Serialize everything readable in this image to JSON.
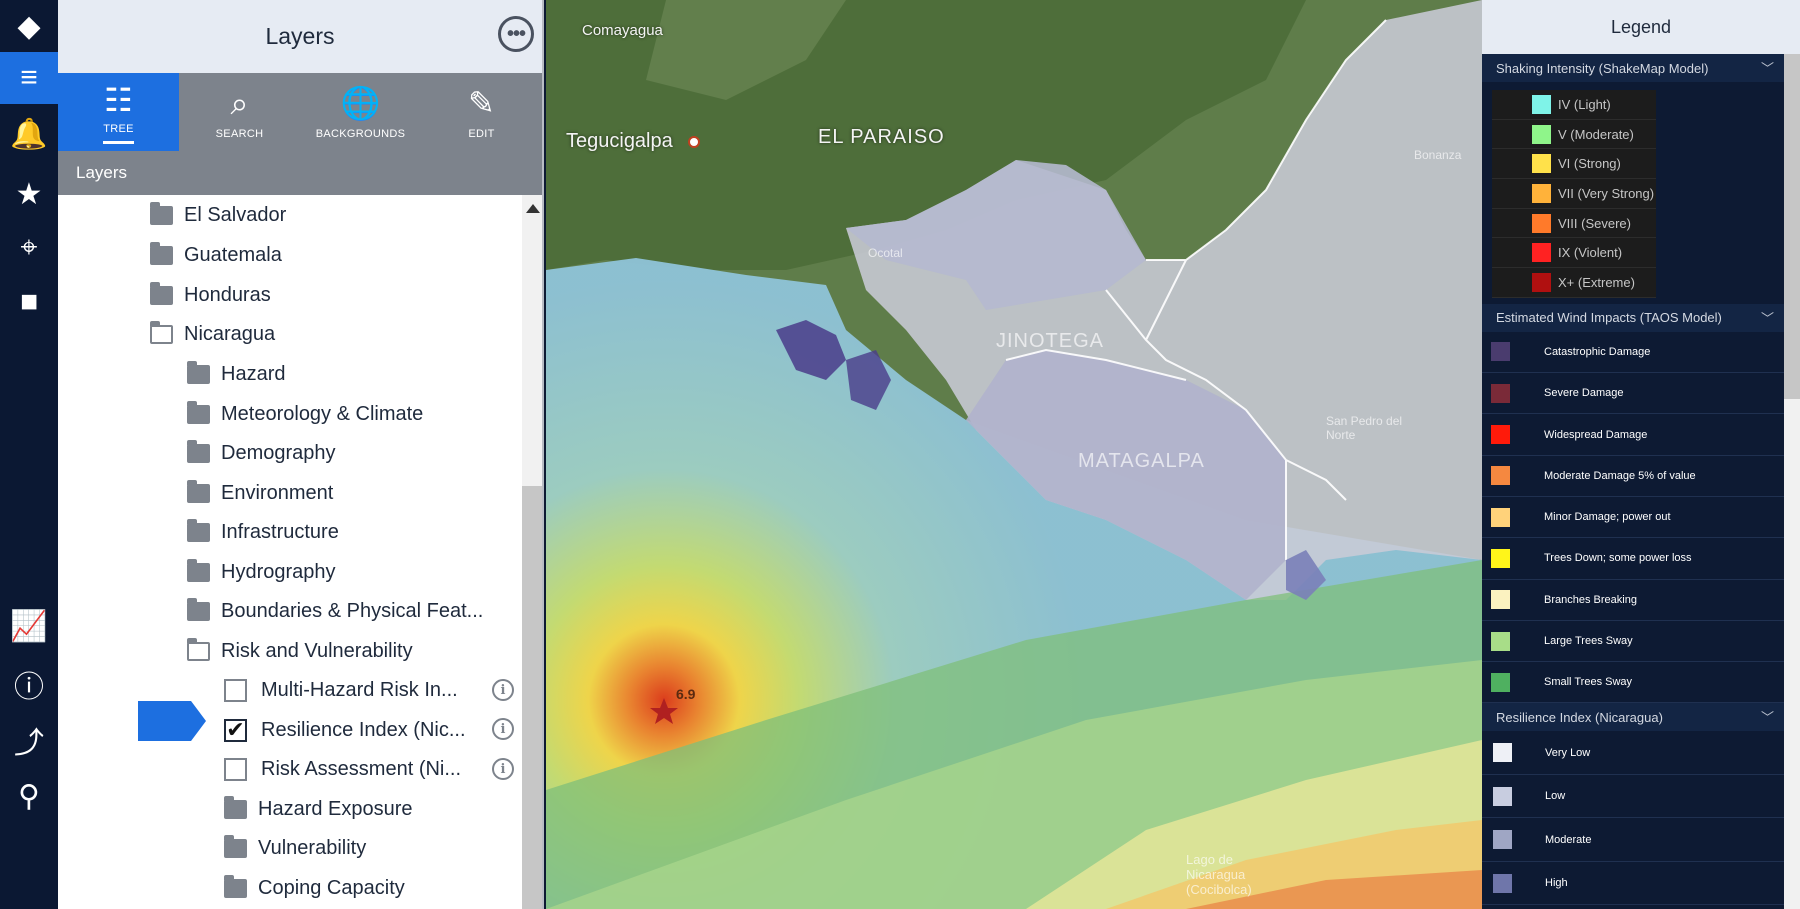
{
  "rail": {
    "items": [
      {
        "name": "alert-diamond-icon",
        "glyph": "◆"
      },
      {
        "name": "layers-stack-icon",
        "glyph": "≡"
      },
      {
        "name": "bell-alert-icon",
        "glyph": "🔔"
      },
      {
        "name": "star-icon",
        "glyph": "★"
      },
      {
        "name": "location-pin-icon",
        "glyph": "⌖"
      },
      {
        "name": "video-camera-icon",
        "glyph": "■"
      },
      {
        "name": "chart-icon",
        "glyph": "📈"
      },
      {
        "name": "info-icon",
        "glyph": "ⓘ"
      },
      {
        "name": "route-icon",
        "glyph": "⤴"
      },
      {
        "name": "map-marker-icon",
        "glyph": "⚲"
      }
    ]
  },
  "panel": {
    "title": "Layers",
    "more_glyph": "•••",
    "tabs": [
      {
        "label": "TREE",
        "glyph": "☷"
      },
      {
        "label": "SEARCH",
        "glyph": "⌕"
      },
      {
        "label": "BACKGROUNDS",
        "glyph": "🌐"
      },
      {
        "label": "EDIT",
        "glyph": "✎"
      }
    ],
    "section": "Layers"
  },
  "tree": {
    "items": [
      {
        "label": "El Salvador",
        "kind": "folder"
      },
      {
        "label": "Guatemala",
        "kind": "folder"
      },
      {
        "label": "Honduras",
        "kind": "folder"
      },
      {
        "label": "Nicaragua",
        "kind": "folder-open"
      },
      {
        "label": "Hazard",
        "kind": "folder"
      },
      {
        "label": "Meteorology & Climate",
        "kind": "folder"
      },
      {
        "label": "Demography",
        "kind": "folder"
      },
      {
        "label": "Environment",
        "kind": "folder"
      },
      {
        "label": "Infrastructure",
        "kind": "folder"
      },
      {
        "label": "Hydrography",
        "kind": "folder"
      },
      {
        "label": "Boundaries & Physical Feat...",
        "kind": "folder"
      },
      {
        "label": "Risk and Vulnerability",
        "kind": "folder-open"
      },
      {
        "label": "Multi-Hazard Risk In...",
        "kind": "layer",
        "checked": false
      },
      {
        "label": "Resilience Index (Nic...",
        "kind": "layer",
        "checked": true
      },
      {
        "label": "Risk Assessment (Ni...",
        "kind": "layer",
        "checked": false
      },
      {
        "label": "Hazard Exposure",
        "kind": "folder"
      },
      {
        "label": "Vulnerability",
        "kind": "folder"
      },
      {
        "label": "Coping Capacity",
        "kind": "folder"
      }
    ],
    "check_glyph": "✔",
    "info_glyph": "i"
  },
  "map": {
    "labels": {
      "comayagua": "Comayagua",
      "tegucigalpa": "Tegucigalpa",
      "el_paraiso": "EL PARAISO",
      "jinotega": "JINOTEGA",
      "matagalpa": "MATAGALPA",
      "ocotal": "Ocotal",
      "san_pedro": "San Pedro del Norte",
      "bonanza": "Bonanza",
      "lago": "Lago de Nicaragua (Cocibolca)",
      "magnitude": "6.9"
    }
  },
  "legend": {
    "title": "Legend",
    "chevron": "﹀",
    "sections": {
      "shaking": {
        "title": "Shaking Intensity (ShakeMap Model)",
        "items": [
          {
            "label": "IV (Light)",
            "color": "#7ff3e8"
          },
          {
            "label": "V (Moderate)",
            "color": "#8ff58a"
          },
          {
            "label": "VI (Strong)",
            "color": "#ffe14a"
          },
          {
            "label": "VII (Very Strong)",
            "color": "#ffb23a"
          },
          {
            "label": "VIII (Severe)",
            "color": "#ff7a2a"
          },
          {
            "label": "IX (Violent)",
            "color": "#ff2222"
          },
          {
            "label": "X+ (Extreme)",
            "color": "#b01010"
          }
        ]
      },
      "wind": {
        "title": "Estimated Wind Impacts (TAOS Model)",
        "items": [
          {
            "label": "Catastrophic Damage",
            "color": "#4a3c6e"
          },
          {
            "label": "Severe Damage",
            "color": "#7a2a38"
          },
          {
            "label": "Widespread Damage",
            "color": "#ff1a0a"
          },
          {
            "label": "Moderate Damage 5% of value",
            "color": "#f58840"
          },
          {
            "label": "Minor Damage; power out",
            "color": "#ffd27a"
          },
          {
            "label": "Trees Down; some power loss",
            "color": "#fff51a"
          },
          {
            "label": "Branches Breaking",
            "color": "#fbf2c0"
          },
          {
            "label": "Large Trees Sway",
            "color": "#a8dd88"
          },
          {
            "label": "Small Trees Sway",
            "color": "#4fb060"
          }
        ]
      },
      "resilience": {
        "title": "Resilience Index (Nicaragua)",
        "items": [
          {
            "label": "Very Low",
            "color": "#eef0f6"
          },
          {
            "label": "Low",
            "color": "#c8cde0"
          },
          {
            "label": "Moderate",
            "color": "#9fa6c4"
          },
          {
            "label": "High",
            "color": "#6f76aa"
          }
        ]
      }
    }
  }
}
